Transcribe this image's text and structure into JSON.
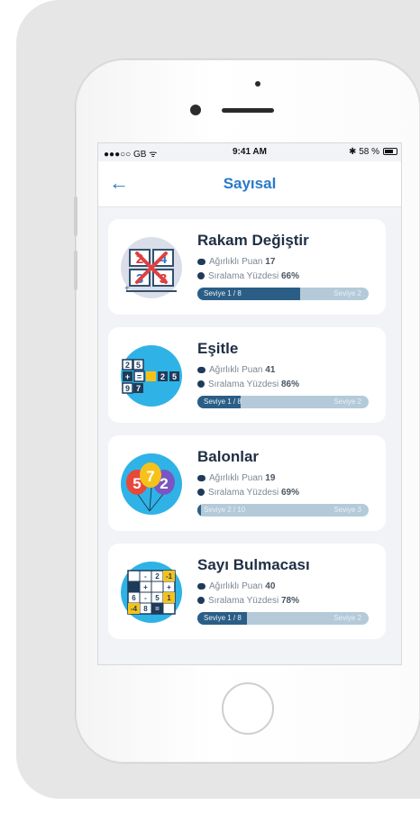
{
  "status": {
    "carrier": "●●●○○ GB ᯤ",
    "time": "9:41 AM",
    "battery": "✱ 58 %"
  },
  "nav": {
    "title": "Sayısal",
    "back": "←"
  },
  "games": [
    {
      "name": "Rakam Değiştir",
      "points_label": "Ağırlıklı Puan",
      "points": "17",
      "rank_label": "Sıralama Yüzdesi",
      "rank": "66%",
      "level": "Seviye 1 / 8",
      "next_level": "Seviye 2",
      "progress": 0.6
    },
    {
      "name": "Eşitle",
      "points_label": "Ağırlıklı Puan",
      "points": "41",
      "rank_label": "Sıralama Yüzdesi",
      "rank": "86%",
      "level": "Seviye 1 / 8",
      "next_level": "Seviye 2",
      "progress": 0.25
    },
    {
      "name": "Balonlar",
      "points_label": "Ağırlıklı Puan",
      "points": "19",
      "rank_label": "Sıralama Yüzdesi",
      "rank": "69%",
      "level": "Seviye 2 / 10",
      "next_level": "Seviye 3",
      "progress": 0.02
    },
    {
      "name": "Sayı Bulmacası",
      "points_label": "Ağırlıklı Puan",
      "points": "40",
      "rank_label": "Sıralama Yüzdesi",
      "rank": "78%",
      "level": "Seviye 1 / 8",
      "next_level": "Seviye 2",
      "progress": 0.29
    }
  ],
  "art": {
    "c1": {
      "n1": "2",
      "n2": "4",
      "n3": "3",
      "n4": "3"
    },
    "c2": {
      "r1": [
        "2",
        "5"
      ],
      "r2": [
        "+",
        "=",
        "2",
        "5"
      ],
      "r3": [
        "9",
        "7"
      ]
    },
    "c3": {
      "b1": "5",
      "b2": "7",
      "b3": "2"
    },
    "c4": {
      "r1": [
        "-",
        "2",
        "-1"
      ],
      "r2": [
        "+",
        "+"
      ],
      "r3": [
        "6",
        "-",
        "5",
        "1"
      ],
      "r4": [
        "-4",
        "8",
        "="
      ]
    }
  },
  "colors": {
    "accent": "#2a79c8",
    "bar_fill": "#2b5e86",
    "bar_track": "#b4cad8"
  }
}
